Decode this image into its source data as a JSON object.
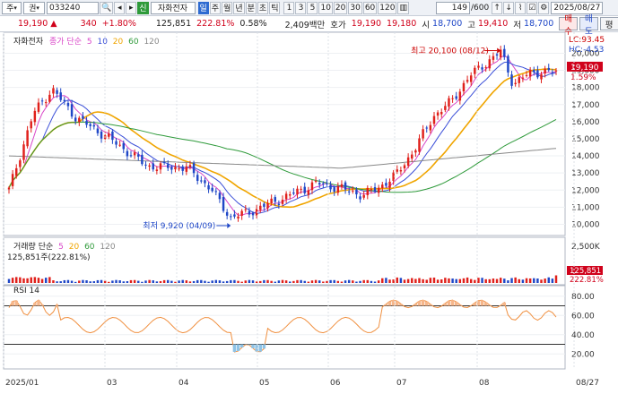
{
  "toolbar": {
    "market": "주",
    "filter": "권",
    "code": "033240",
    "badge": "신",
    "name": "자화전자",
    "periods": [
      "일",
      "주",
      "월",
      "년",
      "분",
      "초",
      "틱"
    ],
    "active_period": "일",
    "intervals": [
      "1",
      "3",
      "5",
      "10",
      "20",
      "30",
      "60",
      "120"
    ],
    "count": "149",
    "count_total": "/600",
    "date": "2025/08/27"
  },
  "quote": {
    "price": "19,190",
    "arrow": "▲",
    "change": "340",
    "change_pct": "+1.80%",
    "volume": "125,851",
    "volume_pct": "222.81%",
    "turnover_pct": "0.58%",
    "amount": "2,409백만",
    "ask_label": "호가",
    "ask": "19,190",
    "bid": "19,180",
    "open_label": "시",
    "open": "18,700",
    "high_label": "고",
    "high": "19,410",
    "low_label": "저",
    "low": "18,700",
    "buy": "매수",
    "sell": "매도",
    "eval": "평"
  },
  "main_legend": {
    "name": "자화전자",
    "label": "종가 단순",
    "ma": [
      "5",
      "10",
      "20",
      "60",
      "120"
    ]
  },
  "annotations": {
    "high": "최고 20,100 (08/12)",
    "low": "최저 9,920 (04/09)",
    "lc": "LC:93.45",
    "hc": "HC:-4.53",
    "last_price": "19,190",
    "last_pct": "1.59%"
  },
  "volume_legend": {
    "label": "거래량 단순",
    "ma": [
      "5",
      "20",
      "60",
      "120"
    ],
    "value": "125,851주(222.81%)",
    "scale": "2,500K",
    "last": "125,851",
    "last_pct": "222.81%"
  },
  "rsi_legend": {
    "label": "RSI 14"
  },
  "price_axis": [
    "20,000",
    "19,000",
    "18,000",
    "17,000",
    "16,000",
    "15,000",
    "14,000",
    "13,000",
    "12,000",
    "11,000",
    "10,000"
  ],
  "rsi_axis": [
    "80.00",
    "60.00",
    "40.00",
    "20.00"
  ],
  "x_axis": [
    "2025/01",
    "03",
    "04",
    "05",
    "06",
    "07",
    "08",
    "08/27"
  ],
  "colors": {
    "up": "#e0201b",
    "down": "#1f47c7",
    "ma5": "#d946c8",
    "ma10": "#3b4fd8",
    "ma20": "#f0a500",
    "ma60": "#2e9a3a",
    "ma120": "#888888",
    "rsi": "#f09040"
  }
}
